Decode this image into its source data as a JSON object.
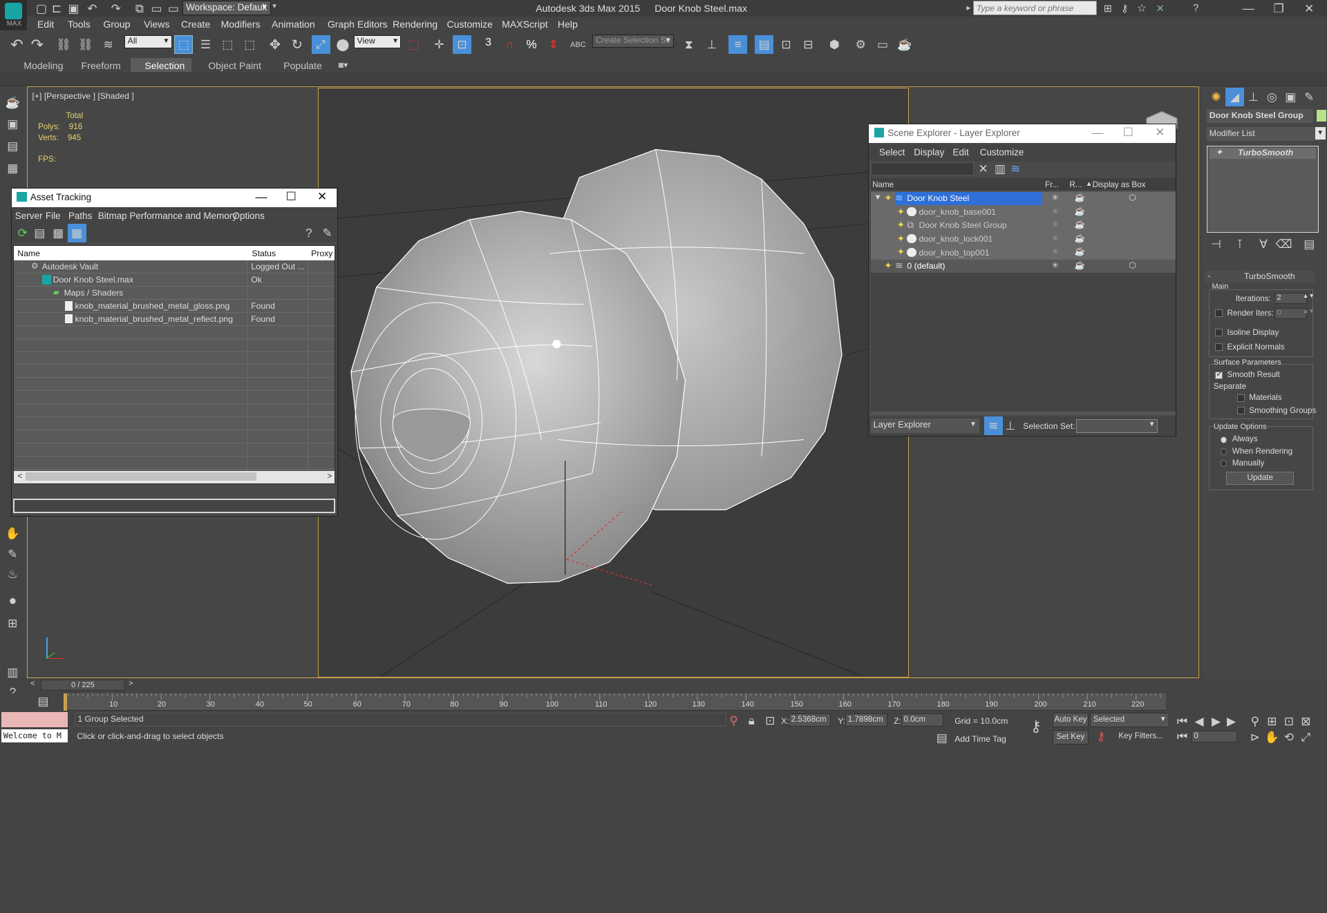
{
  "title_bar": {
    "workspace": "Workspace: Default",
    "app_title": "Autodesk 3ds Max  2015",
    "file_title": "Door Knob Steel.max",
    "search_placeholder": "Type a keyword or phrase",
    "logo": "MAX"
  },
  "menu": [
    "Edit",
    "Tools",
    "Group",
    "Views",
    "Create",
    "Modifiers",
    "Animation",
    "Graph Editors",
    "Rendering",
    "Customize",
    "MAXScript",
    "Help"
  ],
  "toolbar": {
    "filter": "All",
    "ref_coord": "View",
    "selection_set": "Create Selection Se",
    "snap_3": "3",
    "snap_pct": "%",
    "abc": "ABC"
  },
  "ribbon_tabs": [
    "Modeling",
    "Freeform",
    "Selection",
    "Object Paint",
    "Populate"
  ],
  "viewport": {
    "label": "[+] [Perspective ] [Shaded ]",
    "stats_total": "Total",
    "polys_label": "Polys:",
    "polys": "916",
    "verts_label": "Verts:",
    "verts": "945",
    "fps_label": "FPS:"
  },
  "asset_tracking": {
    "title": "Asset Tracking",
    "menus": [
      "Server",
      "File",
      "Paths",
      "Bitmap Performance and Memory",
      "Options"
    ],
    "columns": [
      "Name",
      "Status",
      "Proxy"
    ],
    "rows": [
      {
        "name": "Autodesk Vault",
        "status": "Logged Out ..."
      },
      {
        "name": "Door Knob Steel.max",
        "status": "Ok"
      },
      {
        "name": "Maps / Shaders",
        "status": ""
      },
      {
        "name": "knob_material_brushed_metal_gloss.png",
        "status": "Found"
      },
      {
        "name": "knob_material_brushed_metal_reflect.png",
        "status": "Found"
      }
    ]
  },
  "scene_explorer": {
    "title": "Scene Explorer - Layer Explorer",
    "menus": [
      "Select",
      "Display",
      "Edit",
      "Customize"
    ],
    "columns": [
      "Name",
      "Fr...",
      "R...",
      "Display as Box"
    ],
    "rows": [
      {
        "name": "Door Knob Steel"
      },
      {
        "name": "door_knob_base001"
      },
      {
        "name": "Door Knob Steel Group"
      },
      {
        "name": "door_knob_lock001"
      },
      {
        "name": "door_knob_top001"
      },
      {
        "name": "0 (default)"
      }
    ],
    "footer_dropdown": "Layer Explorer",
    "selection_set_label": "Selection Set:"
  },
  "command_panel": {
    "object_name": "Door Knob Steel Group",
    "modifier_list": "Modifier List",
    "stack_item": "TurboSmooth",
    "rollout_title": "TurboSmooth",
    "main_label": "Main",
    "iterations_label": "Iterations:",
    "iterations": "2",
    "render_iters_label": "Render Iters:",
    "render_iters": "0",
    "isoline": "Isoline Display",
    "explicit": "Explicit Normals",
    "surface_params": "Surface Parameters",
    "smooth_result": "Smooth Result",
    "separate": "Separate",
    "materials": "Materials",
    "smoothing_groups": "Smoothing Groups",
    "update_options": "Update Options",
    "always": "Always",
    "when_rendering": "When Rendering",
    "manually": "Manually",
    "update_btn": "Update"
  },
  "time_slider": {
    "text": "0 / 225",
    "ticks": [
      "10",
      "20",
      "30",
      "40",
      "50",
      "60",
      "70",
      "80",
      "90",
      "100",
      "110",
      "120",
      "130",
      "140",
      "150",
      "160",
      "170",
      "180",
      "190",
      "200",
      "210",
      "220"
    ]
  },
  "status": {
    "welcome": "Welcome to M",
    "selected": "1 Group Selected",
    "prompt": "Click or click-and-drag to select objects",
    "x_label": "X:",
    "x": "2.5368cm",
    "y_label": "Y:",
    "y": "1.7898cm",
    "z_label": "Z:",
    "z": "0.0cm",
    "grid": "Grid = 10.0cm",
    "add_time_tag": "Add Time Tag",
    "auto_key": "Auto Key",
    "selected_dropdown": "Selected",
    "set_key": "Set Key",
    "key_filters": "Key Filters...",
    "frame": "0"
  }
}
